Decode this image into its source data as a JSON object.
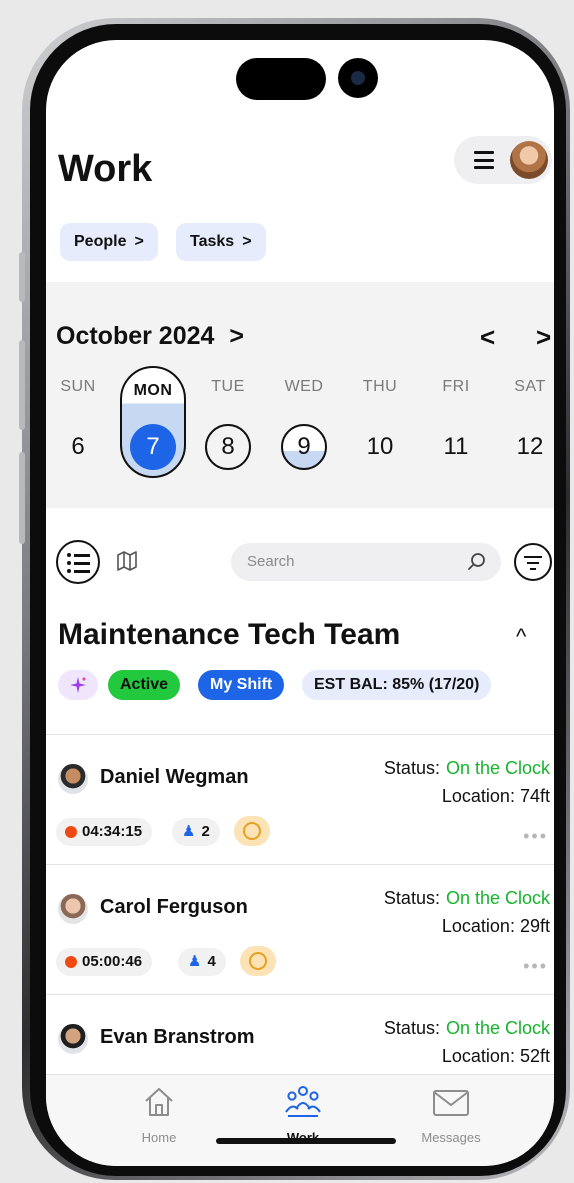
{
  "header": {
    "title": "Work"
  },
  "chips": [
    {
      "label": "People",
      "chevron": ">"
    },
    {
      "label": "Tasks",
      "chevron": ">"
    }
  ],
  "calendar": {
    "month": "October 2024",
    "month_chevron": ">",
    "prev": "<",
    "next": ">",
    "days": [
      {
        "dow": "SUN",
        "num": "6"
      },
      {
        "dow": "MON",
        "num": "7"
      },
      {
        "dow": "TUE",
        "num": "8"
      },
      {
        "dow": "WED",
        "num": "9"
      },
      {
        "dow": "THU",
        "num": "10"
      },
      {
        "dow": "FRI",
        "num": "11"
      },
      {
        "dow": "SAT",
        "num": "12"
      }
    ]
  },
  "search": {
    "placeholder": "Search"
  },
  "team": {
    "title": "Maintenance Tech Team",
    "collapse": "^",
    "badges": {
      "active": "Active",
      "shift": "My Shift",
      "est": "EST BAL: 85% (17/20)"
    }
  },
  "members": [
    {
      "name": "Daniel Wegman",
      "status_label": "Status:",
      "status": "On the Clock",
      "location_label": "Location:",
      "location": "74ft",
      "timer": "04:34:15",
      "count": "2"
    },
    {
      "name": "Carol Ferguson",
      "status_label": "Status:",
      "status": "On the Clock",
      "location_label": "Location:",
      "location": "29ft",
      "timer": "05:00:46",
      "count": "4"
    },
    {
      "name": "Evan Branstrom",
      "status_label": "Status:",
      "status": "On the Clock",
      "location_label": "Location:",
      "location": "52ft"
    }
  ],
  "more_glyph": "•••",
  "tabs": [
    {
      "label": "Home",
      "icon": "home-icon"
    },
    {
      "label": "Work",
      "icon": "people-icon"
    },
    {
      "label": "Messages",
      "icon": "mail-icon"
    }
  ],
  "colors": {
    "accent": "#1e64e6",
    "active": "#22c83e",
    "status_green": "#17b32e",
    "timer_dot": "#f04a12"
  }
}
